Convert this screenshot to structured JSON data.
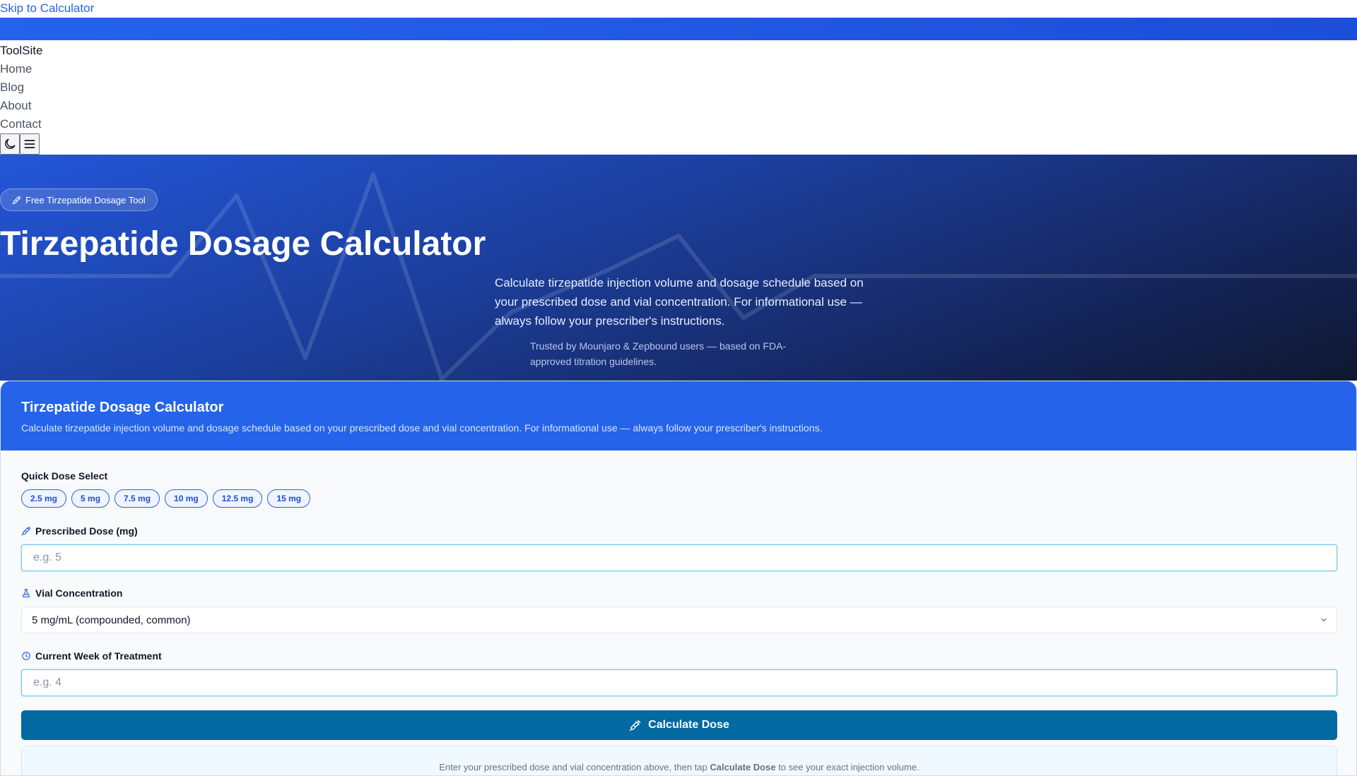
{
  "skip_link": "Skip to Calculator",
  "nav": {
    "logo": "ToolSite",
    "links": [
      "Home",
      "Blog",
      "About",
      "Contact"
    ],
    "theme_icon": "moon-icon",
    "menu_icon": "menu-icon"
  },
  "hero": {
    "badge": "Free Tirzepatide Dosage Tool",
    "title": "Tirzepatide Dosage Calculator",
    "description": "Calculate tirzepatide injection volume and dosage schedule based on your prescribed dose and vial concentration. For informational use — always follow your prescriber's instructions.",
    "trust": "Trusted by Mounjaro & Zepbound users — based on FDA-approved titration guidelines."
  },
  "calculator": {
    "title": "Tirzepatide Dosage Calculator",
    "description": "Calculate tirzepatide injection volume and dosage schedule based on your prescribed dose and vial concentration. For informational use — always follow your prescriber's instructions.",
    "quick_dose_label": "Quick Dose Select",
    "quick_doses": [
      "2.5 mg",
      "5 mg",
      "7.5 mg",
      "10 mg",
      "12.5 mg",
      "15 mg"
    ],
    "dose_label": "Prescribed Dose (mg)",
    "dose_placeholder": "e.g. 5",
    "concentration_label": "Vial Concentration",
    "concentration_value": "5 mg/mL (compounded, common)",
    "week_label": "Current Week of Treatment",
    "week_placeholder": "e.g. 4",
    "button_label": "Calculate Dose",
    "hint_prefix": "Enter your prescribed dose and vial concentration above, then tap ",
    "hint_bold": "Calculate Dose",
    "hint_suffix": " to see your exact injection volume."
  },
  "colors": {
    "primary": "#2563eb",
    "button": "#0369a1"
  }
}
